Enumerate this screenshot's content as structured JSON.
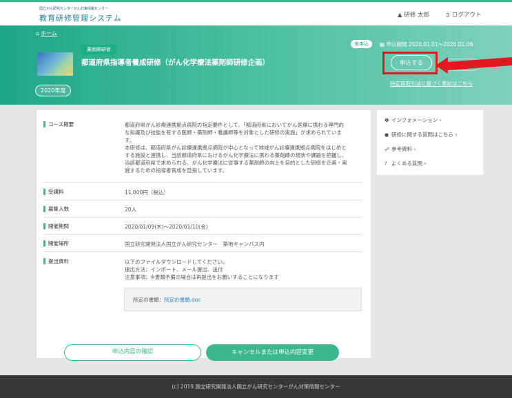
{
  "header": {
    "org": "国立がん研究センターがん対策情報センター",
    "system_name": "教育研修管理システム",
    "user_icon": "person-icon",
    "user_name": "研修 太郎",
    "logout_icon": "logout-icon",
    "logout_label": "ログアウト"
  },
  "hero": {
    "home_icon": "home-icon",
    "breadcrumb_home": "ホーム",
    "category": "薬剤師研修",
    "title": "都道府県指導者養成研修（がん化学療法薬剤師研修企画）",
    "year": "2020年度",
    "status": "未申込",
    "period": "申込期間 2020.01.01～2020.01.08",
    "apply_button": "申込する",
    "law_link": "特定商取引法に基づく表記はこちら",
    "highlight_color": "#e2191f",
    "accent_color": "#3bb88f"
  },
  "details": {
    "overview_label": "コース概要",
    "overview_lines": [
      "都道府県がん診療連携拠点病院の指定要件として、「都道府県においてがん医療に携わる専門的",
      "な知識及び技能を有する医師・薬剤師・看護師等を対象とした研修の実施」が求められていま",
      "す。",
      "本研修は、都道府県がん診療連携拠点病院が中心となって地域がん診療連携拠点病院をはじめと",
      "する施設と連携し、当該都道府県におけるがん化学療法に携わる薬剤師の現状や課題を把握し、",
      "当該都道府県で求められる、がん化学療法に従事する薬剤師の向上を目的とした研修を企画・実",
      "施するための指導者育成を目指しています。"
    ],
    "fee_label": "受講料",
    "fee": "11,000円（税込）",
    "capacity_label": "募集人数",
    "capacity": "20人",
    "dates_label": "開催期間",
    "dates": "2020/01/09(木)～2020/01/10(金)",
    "venue_label": "開催場所",
    "venue": "国立研究開発法人国立がん研究センター　築地キャンパス内",
    "docs_label": "提出資料",
    "docs_lines": [
      "以下のファイルダウンロードしてください。",
      "提出方法：インポート、メール提出、送付",
      "注意事項：※書類不備の場合は再提出をお願いすることになります"
    ],
    "file_label": "所定の書類：",
    "file_link": "所定の書類.doc"
  },
  "sidebar": {
    "items": [
      {
        "icon": "info-icon",
        "label": "インフォメーション ›"
      },
      {
        "icon": "chat-icon",
        "label": "研修に関する質問はこちら ›"
      },
      {
        "icon": "link-icon",
        "label": "参考資料 ›"
      },
      {
        "icon": "question-icon",
        "label": "よくある質問 ›"
      }
    ]
  },
  "actions": {
    "confirm_label": "申込内容の確認",
    "cancel_label": "キャンセルまたは申込内容変更"
  },
  "footer": {
    "copyright": "(c) 2019 国立研究開発法人国立がん研究センターがん対策情報センター"
  }
}
